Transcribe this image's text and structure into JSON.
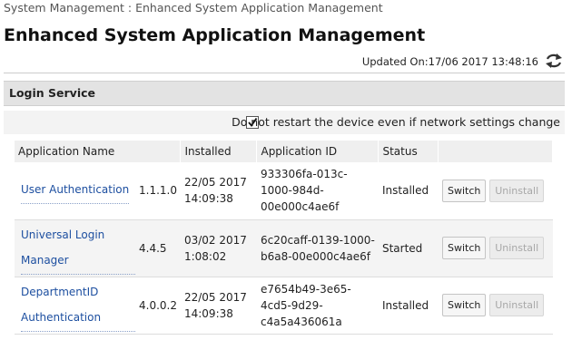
{
  "breadcrumb": "System Management : Enhanced System Application Management",
  "title": "Enhanced System Application Management",
  "updated": "Updated On:17/06 2017 13:48:16",
  "section": {
    "title": "Login Service"
  },
  "option": {
    "label": "Do not restart the device even if network settings change",
    "checked": true
  },
  "table": {
    "headers": [
      "Application Name",
      "Installed",
      "Application ID",
      "Status"
    ],
    "rows": [
      {
        "name": "User Authentication",
        "version": "1.1.1.0",
        "installed": "22/05 2017 14:09:38",
        "id": "933306fa-013c-1000-984d-00e000c4ae6f",
        "status": "Installed",
        "switch_label": "Switch",
        "uninstall_label": "Uninstall"
      },
      {
        "name": "Universal Login Manager",
        "version": "4.4.5",
        "installed": "03/02 2017 1:08:02",
        "id": "6c20caff-0139-1000-b6a8-00e000c4ae6f",
        "status": "Started",
        "switch_label": "Switch",
        "uninstall_label": "Uninstall"
      },
      {
        "name": "DepartmentID Authentication",
        "version": "4.0.0.2",
        "installed": "22/05 2017 14:09:38",
        "id": "e7654b49-3e65-4cd5-9d29-c4a5a436061a",
        "status": "Installed",
        "switch_label": "Switch",
        "uninstall_label": "Uninstall"
      }
    ]
  },
  "icons": {
    "refresh": "refresh-icon",
    "checkmark": "checkmark-icon"
  }
}
